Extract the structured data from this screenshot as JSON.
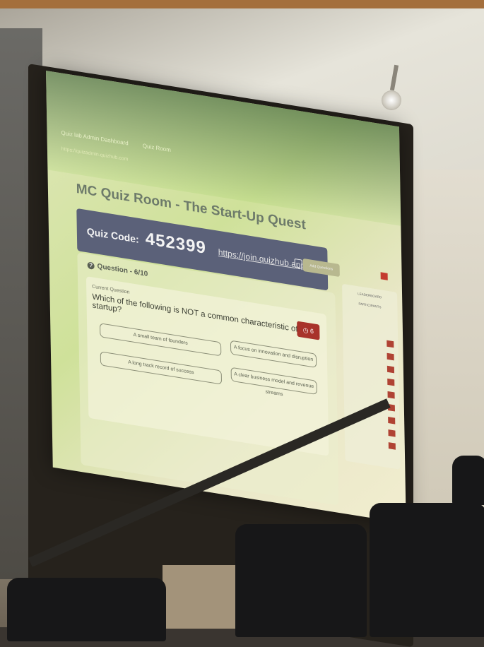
{
  "screen": {
    "tabs": [
      "Quiz lab Admin Dashboard",
      "Quiz Room"
    ],
    "url": "https://quizadmin.quizhub.com",
    "title": "MC Quiz Room - The Start-Up Quest",
    "quiz_code_label": "Quiz Code:",
    "quiz_code": "452399",
    "join_link": "https://join.quizhub.app",
    "add_questions_label": "Add Questions",
    "question_header": "Question - 6/10",
    "current_question_label": "Current Question",
    "question_text": "Which of the following is NOT a common characteristic of a startup?",
    "timer": "6",
    "options": [
      "A small team of founders",
      "A focus on innovation and disruption",
      "A long track record of success",
      "A clear business model and revenue streams"
    ],
    "leaderboard": {
      "title": "LEADERBOARD",
      "subtitle": "PARTICIPANTS",
      "entries": 9
    }
  }
}
